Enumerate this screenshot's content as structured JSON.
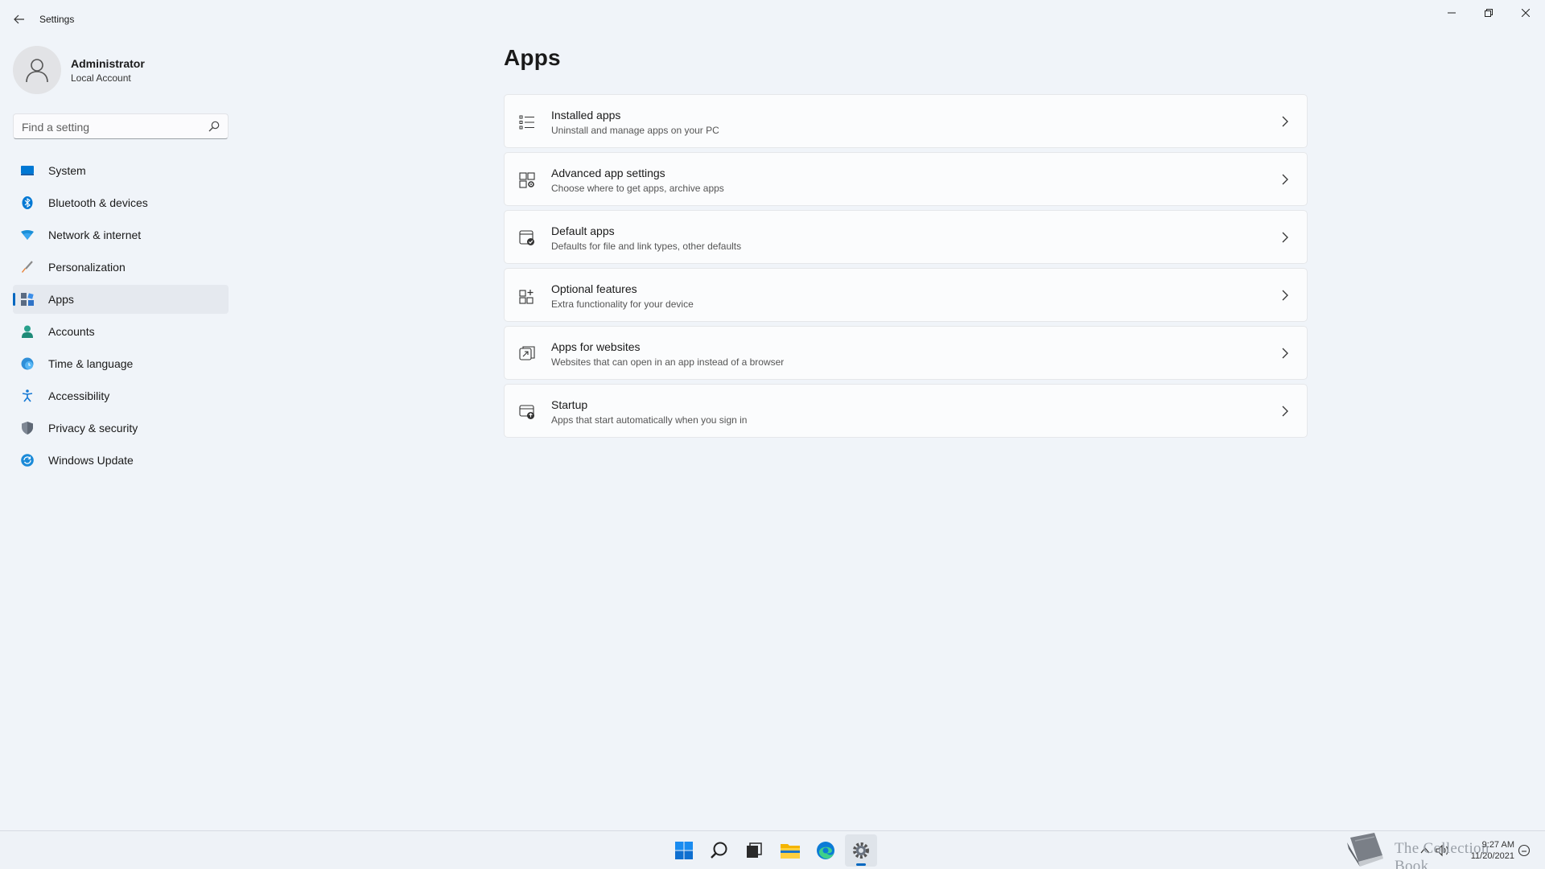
{
  "window": {
    "title": "Settings",
    "controls": [
      "minimize",
      "restore",
      "close"
    ]
  },
  "user": {
    "name": "Administrator",
    "account_type": "Local Account"
  },
  "search": {
    "placeholder": "Find a setting"
  },
  "sidebar": {
    "items": [
      {
        "label": "System",
        "icon": "system-icon",
        "active": false
      },
      {
        "label": "Bluetooth & devices",
        "icon": "bluetooth-icon",
        "active": false
      },
      {
        "label": "Network & internet",
        "icon": "network-icon",
        "active": false
      },
      {
        "label": "Personalization",
        "icon": "brush-icon",
        "active": false
      },
      {
        "label": "Apps",
        "icon": "apps-icon",
        "active": true
      },
      {
        "label": "Accounts",
        "icon": "accounts-icon",
        "active": false
      },
      {
        "label": "Time & language",
        "icon": "time-language-icon",
        "active": false
      },
      {
        "label": "Accessibility",
        "icon": "accessibility-icon",
        "active": false
      },
      {
        "label": "Privacy & security",
        "icon": "shield-icon",
        "active": false
      },
      {
        "label": "Windows Update",
        "icon": "update-icon",
        "active": false
      }
    ]
  },
  "main": {
    "title": "Apps",
    "cards": [
      {
        "title": "Installed apps",
        "subtitle": "Uninstall and manage apps on your PC",
        "icon": "list-icon"
      },
      {
        "title": "Advanced app settings",
        "subtitle": "Choose where to get apps, archive apps",
        "icon": "app-settings-icon"
      },
      {
        "title": "Default apps",
        "subtitle": "Defaults for file and link types, other defaults",
        "icon": "default-apps-icon"
      },
      {
        "title": "Optional features",
        "subtitle": "Extra functionality for your device",
        "icon": "optional-features-icon"
      },
      {
        "title": "Apps for websites",
        "subtitle": "Websites that can open in an app instead of a browser",
        "icon": "open-external-icon"
      },
      {
        "title": "Startup",
        "subtitle": "Apps that start automatically when you sign in",
        "icon": "startup-icon"
      }
    ]
  },
  "taskbar": {
    "apps": [
      "start-icon",
      "search-icon",
      "task-view-icon",
      "file-explorer-icon",
      "edge-icon",
      "settings-icon"
    ],
    "active_app": "settings-icon",
    "watermark_text": "The Collection Book",
    "clock": {
      "time": "9:27 AM",
      "date": "11/20/2021"
    }
  },
  "colors": {
    "accent": "#0067c0",
    "background": "#f0f4f9",
    "card": "#fbfcfd"
  }
}
